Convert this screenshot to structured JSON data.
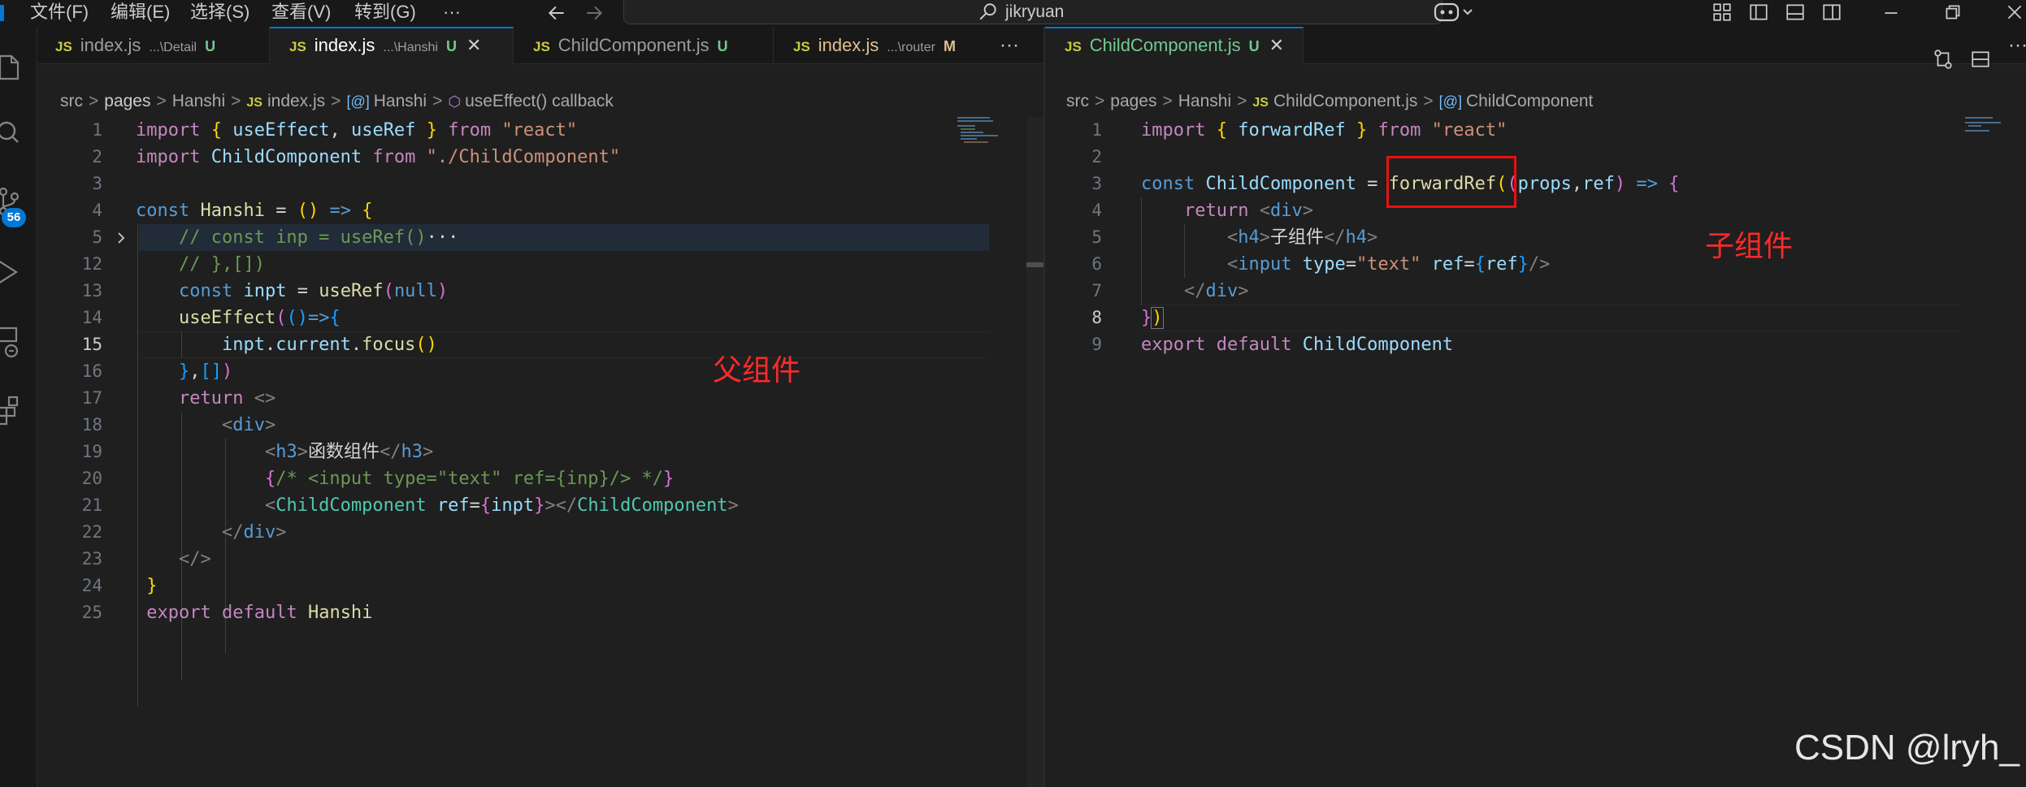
{
  "titlebar": {
    "menu": [
      "文件(F)",
      "编辑(E)",
      "选择(S)",
      "查看(V)",
      "转到(G)",
      "···"
    ],
    "search_text": "jikryuan",
    "back_icon": "arrow-left-icon",
    "forward_icon": "arrow-right-icon"
  },
  "activity_bar": {
    "icons": [
      "explorer-icon",
      "search-icon",
      "source-control-icon",
      "run-debug-icon",
      "remote-explorer-icon",
      "extensions-icon"
    ],
    "scm_badge": "56"
  },
  "left_editor": {
    "tabs": [
      {
        "icon": "JS",
        "name": "index.js",
        "desc": "...\\Detail",
        "status": "U"
      },
      {
        "icon": "JS",
        "name": "index.js",
        "desc": "...\\Hanshi",
        "status": "U",
        "close": "✕"
      },
      {
        "icon": "JS",
        "name": "ChildComponent.js",
        "desc": "",
        "status": "U"
      },
      {
        "icon": "JS",
        "name": "index.js",
        "desc": "...\\router",
        "status": "M"
      }
    ],
    "more": "···",
    "breadcrumb": [
      "src",
      "pages",
      "Hanshi",
      "index.js",
      "Hanshi",
      "useEffect() callback"
    ],
    "line_numbers": [
      "1",
      "2",
      "3",
      "4",
      "5",
      "12",
      "13",
      "14",
      "15",
      "16",
      "17",
      "18",
      "19",
      "20",
      "21",
      "22",
      "23",
      "24",
      "25"
    ],
    "current_line": "15",
    "annotation": "父组件"
  },
  "right_editor": {
    "tab": {
      "icon": "JS",
      "name": "ChildComponent.js",
      "status": "U",
      "close": "✕"
    },
    "breadcrumb": [
      "src",
      "pages",
      "Hanshi",
      "ChildComponent.js",
      "ChildComponent"
    ],
    "line_numbers": [
      "1",
      "2",
      "3",
      "4",
      "5",
      "6",
      "7",
      "8",
      "9"
    ],
    "current_line": "8",
    "annotation": "子组件"
  },
  "watermark": "CSDN @lryh_",
  "colors": {
    "accent": "#0078d4",
    "annotation": "#ff2a2a",
    "keyword": "#569cd6",
    "string": "#ce9178"
  }
}
